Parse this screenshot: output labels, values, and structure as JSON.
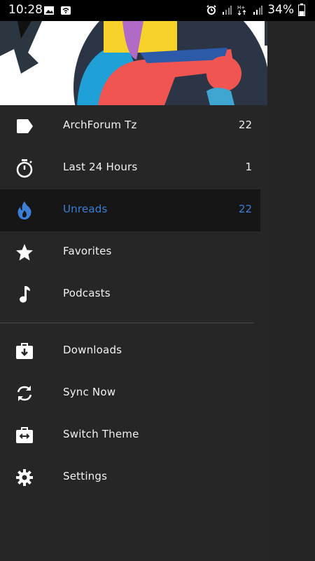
{
  "status_bar": {
    "time": "10:28",
    "battery": "34%"
  },
  "colors": {
    "background": "#262626",
    "active_accent": "#3b7fd6",
    "active_row": "#161616"
  },
  "drawer": {
    "items": [
      {
        "label": "ArchForum Tz",
        "count": "22",
        "icon": "label-tag-icon"
      },
      {
        "label": "Last 24 Hours",
        "count": "1",
        "icon": "stopwatch-icon"
      },
      {
        "label": "Unreads",
        "count": "22",
        "icon": "flame-icon",
        "active": true
      },
      {
        "label": "Favorites",
        "count": "",
        "icon": "star-icon"
      },
      {
        "label": "Podcasts",
        "count": "",
        "icon": "music-note-icon"
      }
    ],
    "secondary_items": [
      {
        "label": "Downloads",
        "icon": "download-briefcase-icon"
      },
      {
        "label": "Sync Now",
        "icon": "sync-icon"
      },
      {
        "label": "Switch Theme",
        "icon": "switch-theme-icon"
      },
      {
        "label": "Settings",
        "icon": "gear-icon"
      }
    ]
  }
}
